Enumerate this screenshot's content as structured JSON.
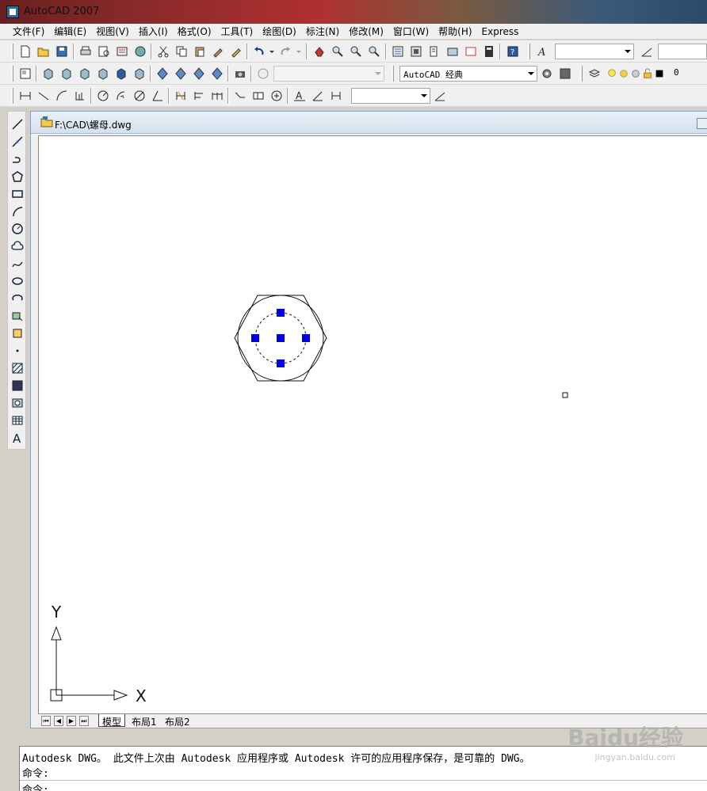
{
  "window": {
    "title": "AutoCAD 2007"
  },
  "menubar": {
    "items": [
      "文件(F)",
      "编辑(E)",
      "视图(V)",
      "插入(I)",
      "格式(O)",
      "工具(T)",
      "绘图(D)",
      "标注(N)",
      "修改(M)",
      "窗口(W)",
      "帮助(H)",
      "Express"
    ]
  },
  "toolbar2": {
    "workspace_combo": "AutoCAD 经典",
    "layer_combo": "0",
    "view_combo": ""
  },
  "toolbar1": {
    "text_style_combo": "",
    "dim_style_combo": ""
  },
  "toolbar3": {
    "dim_combo": ""
  },
  "document": {
    "title": "F:\\CAD\\螺母.dwg"
  },
  "layout_tabs": [
    "模型",
    "布局1",
    "布局2"
  ],
  "ucs": {
    "x_label": "X",
    "y_label": "Y"
  },
  "command": {
    "line1": "Autodesk DWG。   此文件上次由 Autodesk 应用程序或 Autodesk 许可的应用程序保存，是可靠的 DWG。",
    "line2": "命令:",
    "line3": "命令:"
  },
  "watermark": {
    "brand": "Baidu经验",
    "url": "jingyan.baidu.com"
  }
}
